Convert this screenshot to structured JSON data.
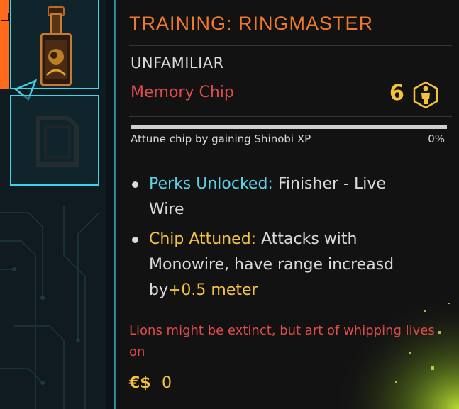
{
  "inventory": {
    "selected_slot": "memory-chip",
    "colors": {
      "slot_border": "#3fd3e6",
      "tab_accent": "#ff6a1a"
    }
  },
  "tooltip": {
    "title": "TRAINING: RINGMASTER",
    "rarity": "UNFAMILIAR",
    "item_type": "Memory Chip",
    "requirement_value": "6",
    "requirement_icon": "body-attribute-icon",
    "progress": {
      "label": "Attune chip by gaining Shinobi XP",
      "percent_text": "0%",
      "fraction": 0
    },
    "bullets": [
      {
        "label": "Perks Unlocked:",
        "text_line1": " Finisher - Live",
        "text_line2": "Wire"
      },
      {
        "label": "Chip Attuned:",
        "text_line1": " Attacks with",
        "text_line2": "Monowire, have range increasd",
        "text_line3_prefix": "by",
        "text_line3_bonus": "+0.5 meter"
      }
    ],
    "lore": "Lions might be extinct, but art of whipping lives on",
    "price": {
      "currency_symbol": "€$",
      "value": "0"
    },
    "colors": {
      "title": "#f07a2c",
      "type": "#e04b4b",
      "highlight_cyan": "#5cd2e6",
      "highlight_yellow": "#f4c33a"
    }
  }
}
